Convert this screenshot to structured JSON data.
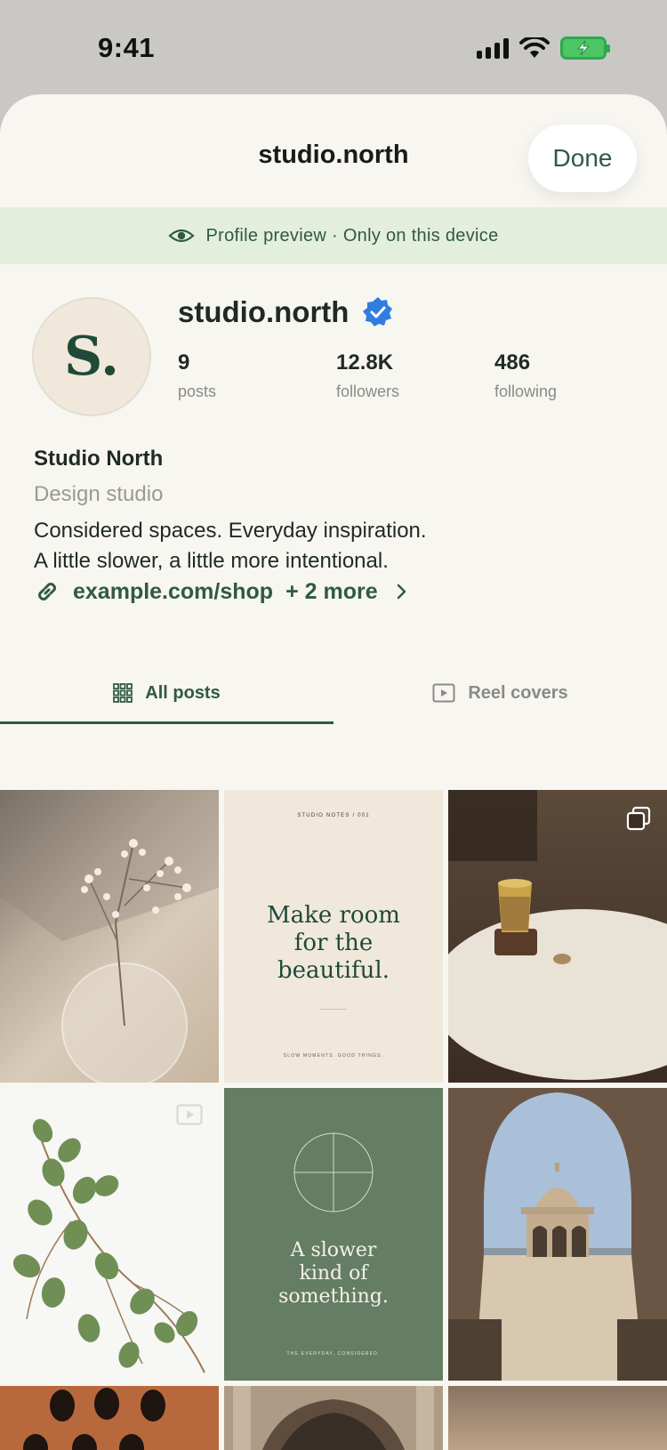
{
  "status_bar": {
    "time": "9:41"
  },
  "header": {
    "title": "studio.north",
    "done_label": "Done"
  },
  "banner": {
    "text": "Profile preview · Only on this device"
  },
  "profile": {
    "avatar_letter": "S.",
    "username": "studio.north",
    "stats": [
      {
        "value": "9",
        "label": "posts"
      },
      {
        "value": "12.8K",
        "label": "followers"
      },
      {
        "value": "486",
        "label": "following"
      }
    ],
    "display_name": "Studio North",
    "category": "Design studio",
    "bio_line1": "Considered spaces. Everyday inspiration.",
    "bio_line2": "A little slower, a little more intentional.",
    "link_text": "example.com/shop",
    "link_more": "+ 2 more"
  },
  "tabs": [
    {
      "label": "All posts",
      "active": true
    },
    {
      "label": "Reel covers",
      "active": false
    }
  ],
  "grid": {
    "tile2": {
      "kicker": "STUDIO NOTES / 001",
      "headline": [
        "Make room",
        "for the",
        "beautiful."
      ],
      "footer": "SLOW MOMENTS. GOOD THINGS."
    },
    "tile5": {
      "headline": [
        "A slower",
        "kind of",
        "something."
      ],
      "footer": "THE EVERYDAY, CONSIDERED."
    }
  },
  "colors": {
    "accent": "#2f5a45",
    "banner_bg": "#e4eedc",
    "sheet_bg": "#f8f6f1",
    "verified": "#2f7de1",
    "green_tile": "#647d63"
  }
}
